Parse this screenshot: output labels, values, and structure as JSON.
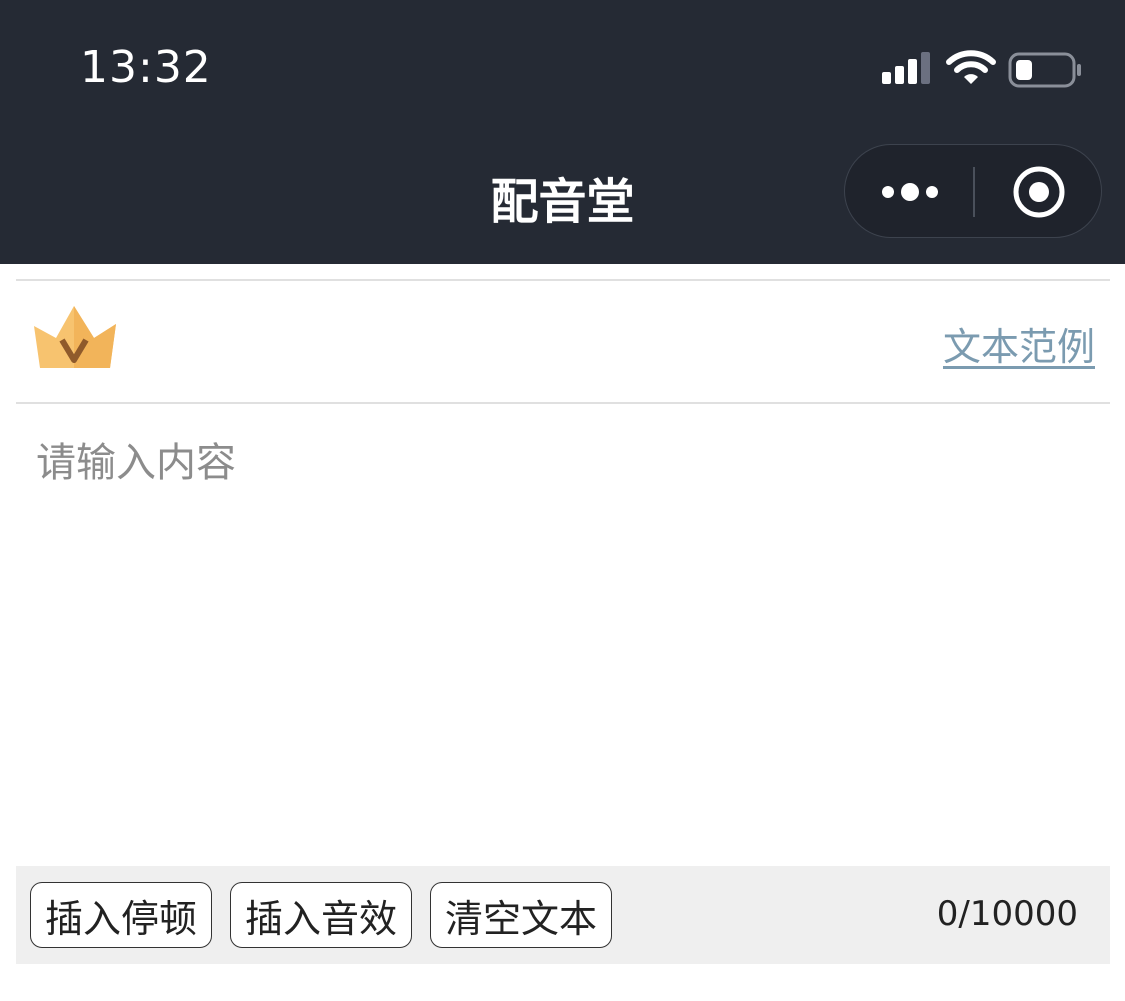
{
  "status_bar": {
    "time": "13:32"
  },
  "nav": {
    "title": "配音堂"
  },
  "toolbar_top": {
    "example_link": "文本范例"
  },
  "editor": {
    "placeholder": "请输入内容",
    "value": ""
  },
  "bottom_toolbar": {
    "buttons": [
      {
        "label": "插入停顿"
      },
      {
        "label": "插入音效"
      },
      {
        "label": "清空文本"
      }
    ],
    "counter": "0/10000"
  },
  "colors": {
    "topbar_bg": "#252a34",
    "link": "#7b9bb0",
    "toolbar_bg": "#efefef",
    "crown": "#f7c36f"
  }
}
